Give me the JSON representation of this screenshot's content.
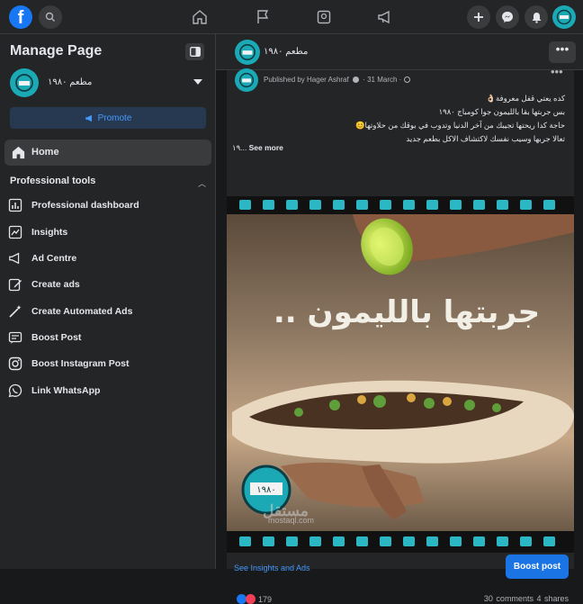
{
  "topbar": {
    "logo_letter": "f",
    "icons": [
      "search-icon",
      "home-icon",
      "flag-icon",
      "photo-icon",
      "megaphone-icon",
      "plus-icon",
      "messenger-icon",
      "bell-icon"
    ]
  },
  "sidebar": {
    "title": "Manage Page",
    "page_name": "مطعم ١٩٨٠",
    "promote_label": "Promote",
    "home_label": "Home",
    "section_title": "Professional tools",
    "items": [
      {
        "label": "Professional dashboard",
        "icon": "dashboard-icon"
      },
      {
        "label": "Insights",
        "icon": "insights-icon"
      },
      {
        "label": "Ad Centre",
        "icon": "megaphone-icon"
      },
      {
        "label": "Create ads",
        "icon": "edit-icon"
      },
      {
        "label": "Create Automated Ads",
        "icon": "wand-icon"
      },
      {
        "label": "Boost Post",
        "icon": "boost-post-icon"
      },
      {
        "label": "Boost Instagram Post",
        "icon": "instagram-icon"
      },
      {
        "label": "Link WhatsApp",
        "icon": "whatsapp-icon"
      }
    ]
  },
  "main": {
    "page_name": "مطعم ١٩٨٠",
    "more_label": "•••"
  },
  "post": {
    "published_by": "Published by Hager Ashraf",
    "date": "31 March",
    "lines": [
      "كده يعتي قفل معروفة👌🏻",
      "بس جربتها بقا بالليمون جوا كومباج ١٩٨٠",
      "حاجة كدا ريحتها تجيبك من آخر الدنيا وتدوب في بوقك من حلاوتها😊",
      "تعالا جربها وسيب نفسك لاكتشاف الاكل بطعم جديد"
    ],
    "see_more_prefix": "١٩...",
    "see_more_label": "See more",
    "image_caption": "جربتها بالليمون ..",
    "logo_text": "١٩٨٠",
    "insights_link": "See Insights and Ads",
    "boost_label": "Boost post",
    "reaction_count": "179",
    "comments": "30 comments",
    "shares": "4 shares",
    "watermark_big": "مستقل",
    "watermark": "mostaql.com"
  },
  "colors": {
    "background": "#18191a",
    "surface": "#242526",
    "accent": "#1b74e4",
    "link": "#4599ff",
    "brand_teal": "#1aa9b5"
  }
}
